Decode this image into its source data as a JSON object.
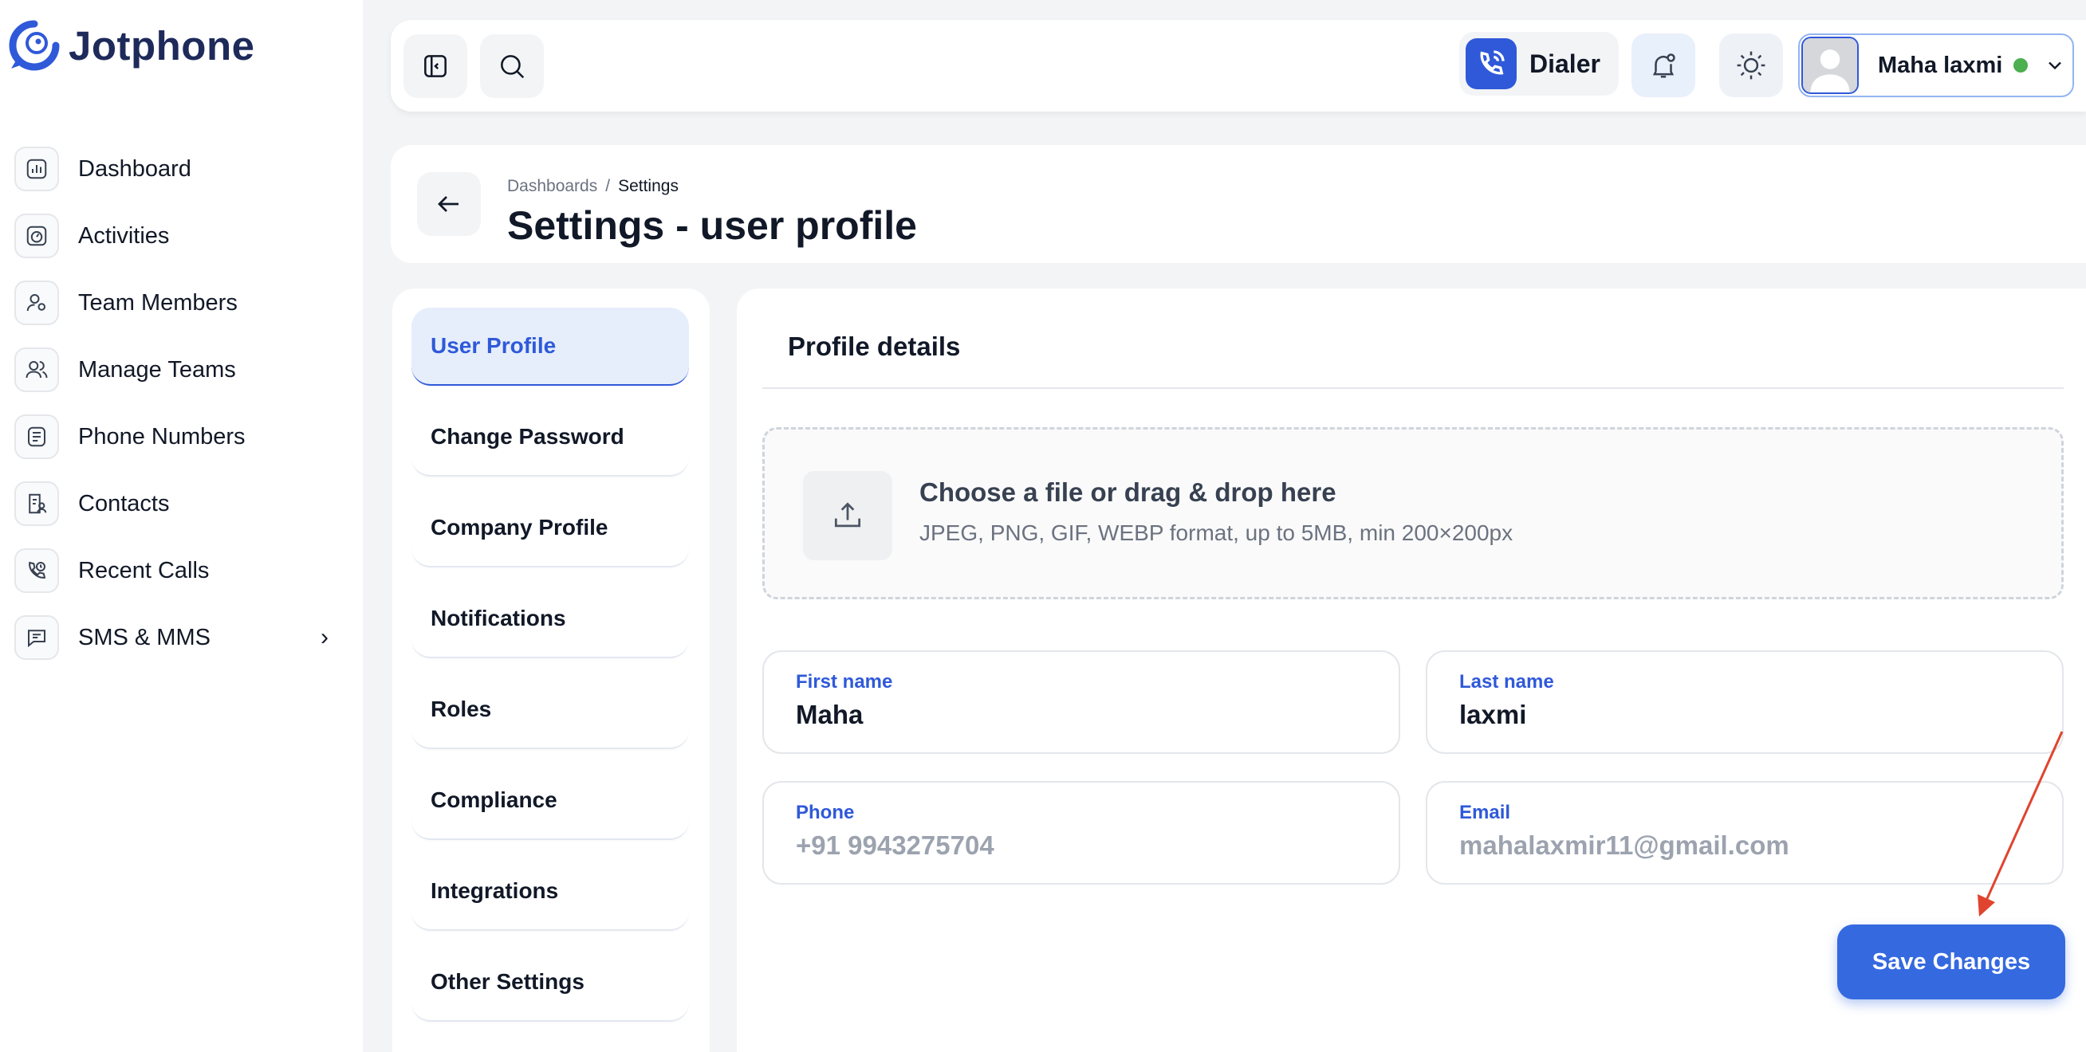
{
  "app": {
    "name": "Jotphone"
  },
  "colors": {
    "accent": "#2f59d9",
    "button": "#3569e0",
    "online": "#4caf50",
    "annotation": "#e0442e"
  },
  "sidebar": {
    "items": [
      {
        "label": "Dashboard",
        "icon": "chart-bar-icon"
      },
      {
        "label": "Activities",
        "icon": "activity-icon"
      },
      {
        "label": "Team Members",
        "icon": "user-settings-icon"
      },
      {
        "label": "Manage Teams",
        "icon": "users-icon"
      },
      {
        "label": "Phone Numbers",
        "icon": "phone-list-icon"
      },
      {
        "label": "Contacts",
        "icon": "contact-list-icon"
      },
      {
        "label": "Recent Calls",
        "icon": "phone-clock-icon"
      },
      {
        "label": "SMS & MMS",
        "icon": "message-icon"
      }
    ]
  },
  "topbar": {
    "dialer_label": "Dialer",
    "user_name": "Maha laxmi"
  },
  "page": {
    "breadcrumb": [
      "Dashboards",
      "Settings"
    ],
    "breadcrumb_sep": "/",
    "title": "Settings - user profile"
  },
  "settings_menu": {
    "items": [
      "User Profile",
      "Change Password",
      "Company Profile",
      "Notifications",
      "Roles",
      "Compliance",
      "Integrations",
      "Other Settings"
    ],
    "active_index": 0
  },
  "profile": {
    "section_title": "Profile details",
    "upload_title": "Choose a file or drag & drop here",
    "upload_hint": "JPEG, PNG, GIF, WEBP format, up to 5MB, min 200×200px",
    "first_name_label": "First name",
    "first_name": "Maha",
    "last_name_label": "Last name",
    "last_name": "laxmi",
    "phone_label": "Phone",
    "phone": "+91 9943275704",
    "email_label": "Email",
    "email": "mahalaxmir11@gmail.com",
    "save_label": "Save Changes"
  }
}
